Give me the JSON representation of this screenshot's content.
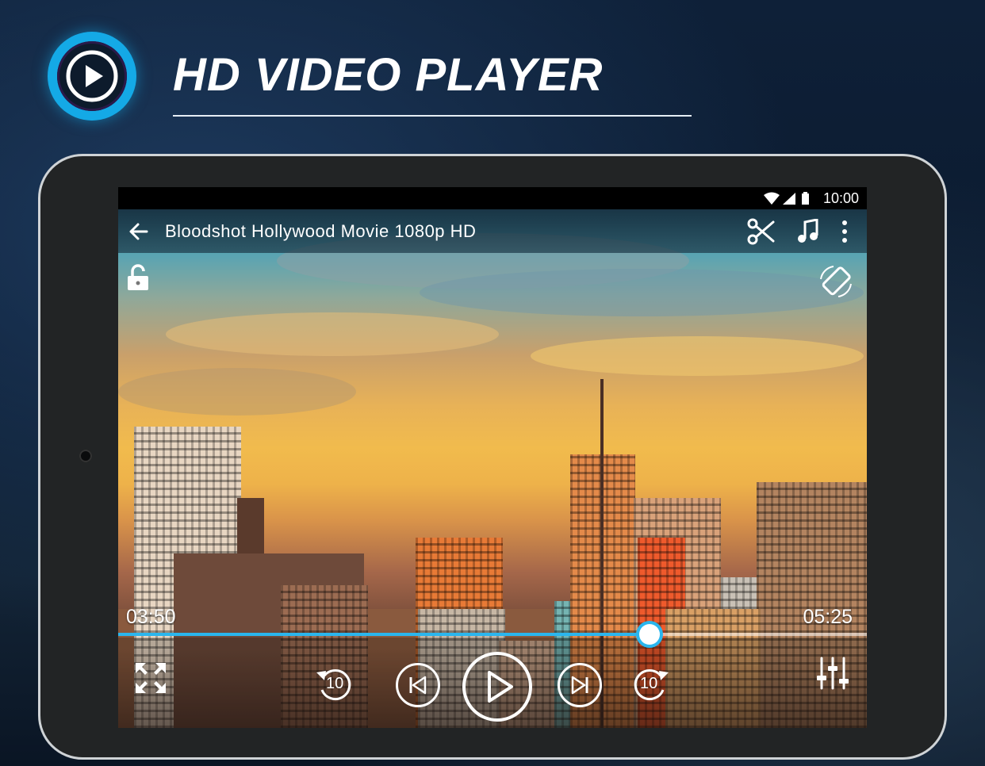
{
  "app": {
    "title": "HD VIDEO PLAYER",
    "accent_color": "#14a9e6"
  },
  "status_bar": {
    "time": "10:00",
    "icons": [
      "wifi-icon",
      "cellular-signal-icon",
      "battery-icon"
    ]
  },
  "player": {
    "video_title": "Bloodshot Hollywood Movie 1080p HD",
    "elapsed": "03:50",
    "duration": "05:25",
    "progress_fraction": 0.71,
    "seek_back_seconds": "10",
    "seek_forward_seconds": "10",
    "seek_color": "#2ab6ee"
  }
}
